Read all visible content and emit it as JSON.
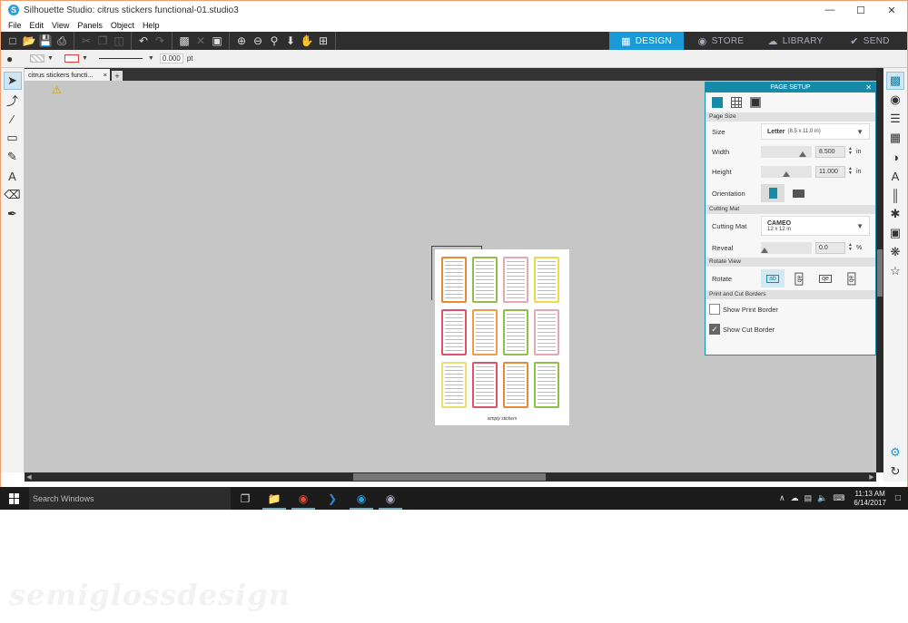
{
  "window": {
    "title": "Silhouette Studio: citrus stickers functional-01.studio3",
    "app_icon_letter": "S",
    "minimize": "—",
    "maximize": "☐",
    "close": "✕"
  },
  "menu": [
    "File",
    "Edit",
    "View",
    "Panels",
    "Object",
    "Help"
  ],
  "modes": {
    "design": "DESIGN",
    "store": "STORE",
    "library": "LIBRARY",
    "send": "SEND"
  },
  "propbar": {
    "line_width": "0.000",
    "unit": "pt"
  },
  "doc_tab": {
    "label": "citrus stickers functi...",
    "close": "×",
    "add": "+"
  },
  "canvas": {
    "sticker_colors": [
      "#e8883a",
      "#8fbf4a",
      "#e8a7b0",
      "#f0d84a",
      "#d9546a",
      "#f09a4a",
      "#8fbf4a",
      "#e8a7b0",
      "#e8e070",
      "#d9546a",
      "#e8883a",
      "#8fbf4a"
    ],
    "page_signature": "simply stickers"
  },
  "panel": {
    "title": "PAGE SETUP",
    "close": "✕",
    "page_size_section": "Page Size",
    "size_label": "Size",
    "size_value": "Letter",
    "size_sub": "(8.5 x 11.0 in)",
    "width_label": "Width",
    "width_value": "8.500",
    "height_label": "Height",
    "height_value": "11.000",
    "unit_in": "in",
    "orientation_label": "Orientation",
    "cutting_mat_section": "Cutting Mat",
    "cutting_mat_label": "Cutting Mat",
    "mat_value": "CAMEO",
    "mat_sub": "12 x 12 in",
    "reveal_label": "Reveal",
    "reveal_value": "0.0",
    "unit_pct": "%",
    "rotate_view_section": "Rotate View",
    "rotate_label": "Rotate",
    "rotate_options": [
      "ab",
      "ab",
      "qe",
      "qe"
    ],
    "print_cut_section": "Print and Cut Borders",
    "show_print_border": "Show Print Border",
    "show_cut_border": "Show Cut Border"
  },
  "taskbar": {
    "search_placeholder": "Search Windows",
    "time": "11:13 AM",
    "date": "6/14/2017"
  },
  "watermark": "semiglossdesign"
}
